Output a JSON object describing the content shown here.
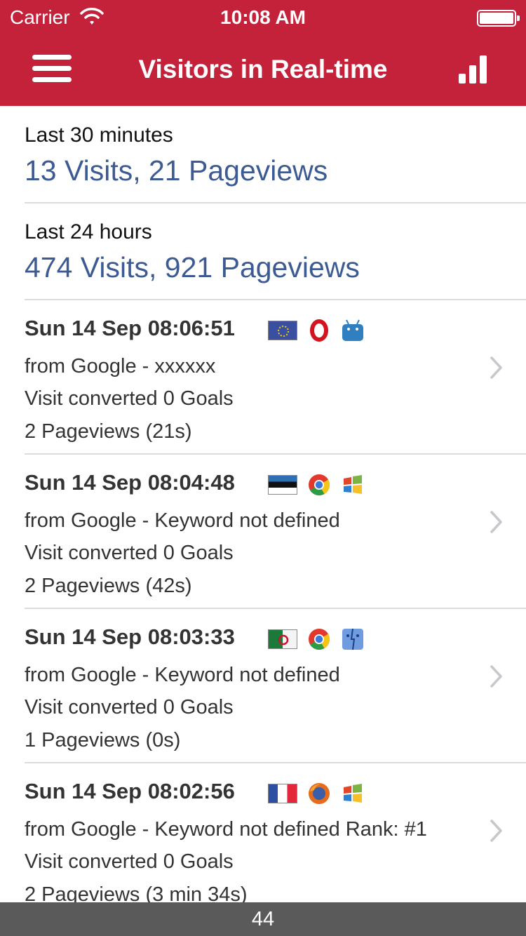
{
  "status_bar": {
    "carrier": "Carrier",
    "time": "10:08 AM"
  },
  "nav": {
    "title": "Visitors in Real-time",
    "menu_icon": "hamburger-menu-icon",
    "right_icon": "bar-chart-icon"
  },
  "colors": {
    "nav_bg": "#c4213a",
    "accent_text": "#3d5b93",
    "footer_bg": "#5a5a5a"
  },
  "summary": [
    {
      "label": "Last 30 minutes",
      "value": "13 Visits, 21 Pageviews"
    },
    {
      "label": "Last 24 hours",
      "value": "474 Visits, 921 Pageviews"
    }
  ],
  "visits": [
    {
      "datetime": "Sun 14 Sep 08:06:51",
      "referrer": "from Google - xxxxxx",
      "goals": "Visit converted 0 Goals",
      "pageviews": "2 Pageviews (21s)",
      "flag": "eu-flag-icon",
      "browser": "opera-icon",
      "os": "android-icon"
    },
    {
      "datetime": "Sun 14 Sep 08:04:48",
      "referrer": "from Google - Keyword not defined",
      "goals": "Visit converted 0 Goals",
      "pageviews": "2 Pageviews (42s)",
      "flag": "estonia-flag-icon",
      "browser": "chrome-icon",
      "os": "windows-icon"
    },
    {
      "datetime": "Sun 14 Sep 08:03:33",
      "referrer": "from Google - Keyword not defined",
      "goals": "Visit converted 0 Goals",
      "pageviews": "1 Pageviews (0s)",
      "flag": "algeria-flag-icon",
      "browser": "chrome-icon",
      "os": "mac-finder-icon"
    },
    {
      "datetime": "Sun 14 Sep 08:02:56",
      "referrer": "from Google - Keyword not defined Rank: #1",
      "goals": "Visit converted 0 Goals",
      "pageviews": "2 Pageviews (3 min 34s)",
      "flag": "france-flag-icon",
      "browser": "firefox-icon",
      "os": "windows-icon"
    }
  ],
  "footer": {
    "count": "44"
  }
}
